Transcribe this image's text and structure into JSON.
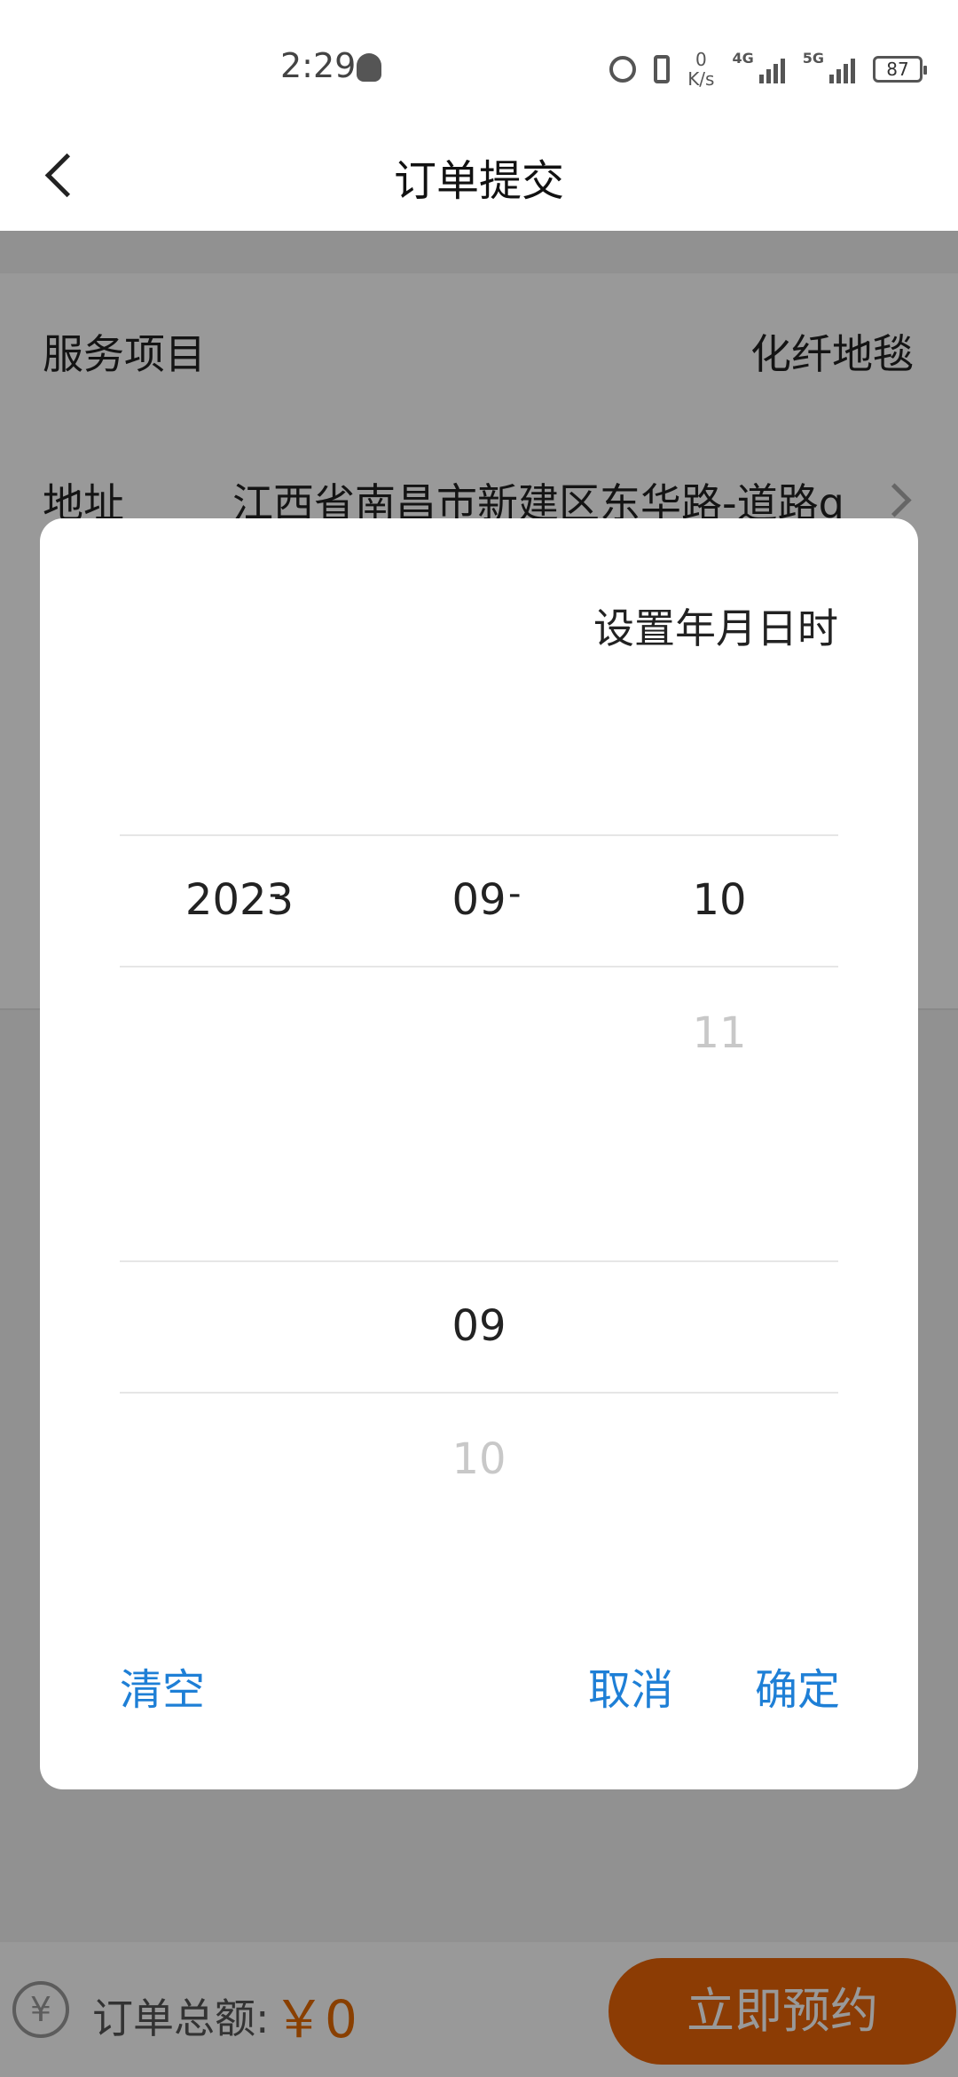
{
  "status_bar": {
    "time": "2:29",
    "speed_value": "0",
    "speed_unit": "K/s",
    "net1": "4G",
    "net2": "5G",
    "battery": "87"
  },
  "header": {
    "title": "订单提交"
  },
  "form": {
    "service_label": "服务项目",
    "service_value": "化纤地毯",
    "address_label": "地址",
    "address_value": "江西省南昌市新建区东华路-道路q"
  },
  "bottom": {
    "currency_icon": "¥",
    "total_label": "订单总额:",
    "total_value": "￥0",
    "book_button": "立即预约"
  },
  "dialog": {
    "title": "设置年月日时",
    "date": {
      "year": "2023",
      "month": "09",
      "day": "10",
      "separator": "-",
      "day_next": "11"
    },
    "hour": {
      "selected": "09",
      "next": "10"
    },
    "clear_button": "清空",
    "cancel_button": "取消",
    "confirm_button": "确定"
  }
}
